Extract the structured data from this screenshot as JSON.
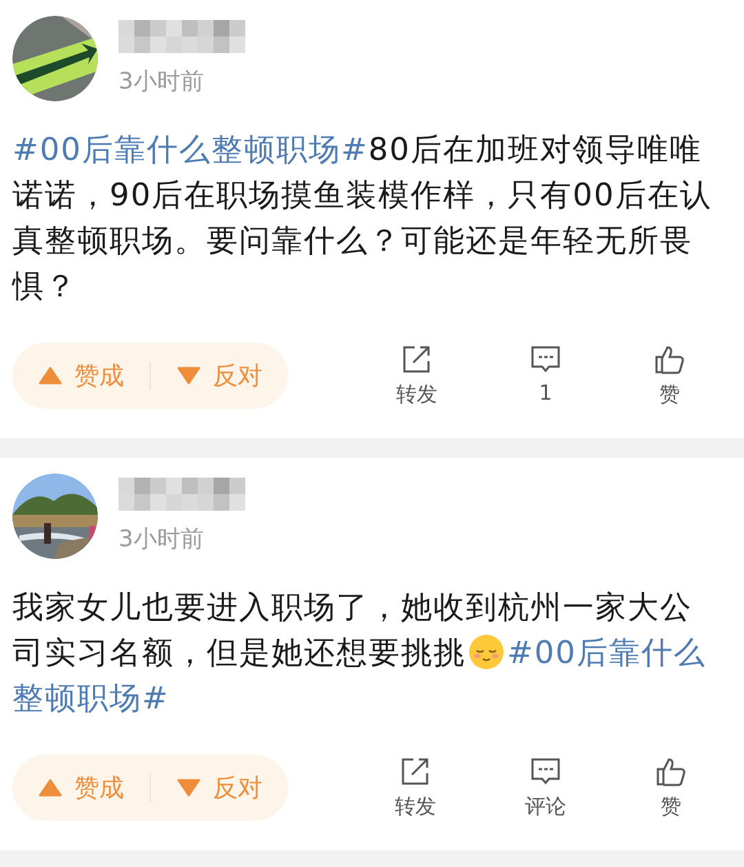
{
  "posts": [
    {
      "author": {
        "blurred": true
      },
      "avatar": {
        "kind": "picture"
      },
      "time": "3小时前",
      "body": [
        {
          "kind": "topic",
          "text": "#00后靠什么整顿职场#"
        },
        {
          "kind": "text",
          "text": "80后在加班对领导唯唯诺诺，90后在职场摸鱼装模作样，只有00后在认真整顿职场。要问靠什么？可能还是年轻无所畏惧？"
        }
      ],
      "vote": {
        "up": "赞成",
        "down": "反对"
      },
      "stats": [
        {
          "kind": "share",
          "label": "转发"
        },
        {
          "kind": "comment",
          "label": "1"
        },
        {
          "kind": "like",
          "label": "赞"
        }
      ]
    },
    {
      "author": {
        "blurred": true
      },
      "avatar": {
        "kind": "picture"
      },
      "time": "3小时前",
      "body": [
        {
          "kind": "text",
          "text": "我家女儿也要进入职场了，她收到杭州一家大公司实习名额，但是她还想要挑挑"
        },
        {
          "kind": "emoji"
        },
        {
          "kind": "topic",
          "text": "#00后靠什么整顿职场#"
        }
      ],
      "vote": {
        "up": "赞成",
        "down": "反对"
      },
      "stats": [
        {
          "kind": "share",
          "label": "转发"
        },
        {
          "kind": "comment",
          "label": "评论"
        },
        {
          "kind": "like",
          "label": "赞"
        }
      ]
    }
  ]
}
